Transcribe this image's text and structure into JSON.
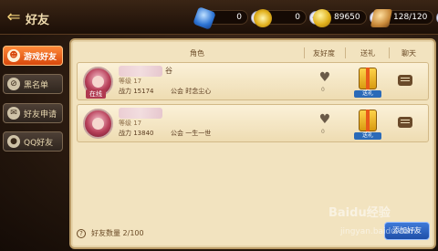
{
  "header": {
    "title": "好友"
  },
  "resources": [
    {
      "icon": "gem-icon",
      "value": "0"
    },
    {
      "icon": "swirl-icon",
      "value": "0"
    },
    {
      "icon": "gold-coin-icon",
      "value": "89650"
    },
    {
      "icon": "stamina-icon",
      "value": "128/120"
    }
  ],
  "sidebar": {
    "tabs": [
      {
        "label": "游戏好友",
        "icon": "friends-icon",
        "active": true
      },
      {
        "label": "黑名单",
        "icon": "block-icon",
        "active": false
      },
      {
        "label": "好友申请",
        "icon": "request-icon",
        "active": false
      },
      {
        "label": "QQ好友",
        "icon": "qq-icon",
        "active": false
      }
    ]
  },
  "table": {
    "columns": [
      "角色",
      "友好度",
      "送礼",
      "聊天"
    ],
    "rows": [
      {
        "status": "在线",
        "name_tail": "谷",
        "level": "等级 17",
        "power": "战力 15174",
        "guild": "公会 时念尘心",
        "affinity": "0",
        "gift_label": "送礼"
      },
      {
        "status": "",
        "name_tail": "",
        "level": "等级 17",
        "power": "战力 13840",
        "guild": "公会 一生一世",
        "affinity": "0",
        "gift_label": "送礼"
      }
    ]
  },
  "footer": {
    "count_text": "好友数量 2/100",
    "button_label": "添加好友"
  },
  "watermark": {
    "brand": "Baidu经验",
    "url": "jingyan.baidu.com"
  },
  "colors": {
    "active_tab": "#e8601c",
    "panel": "#f2e3bf",
    "online_tag": "#b03a50"
  }
}
